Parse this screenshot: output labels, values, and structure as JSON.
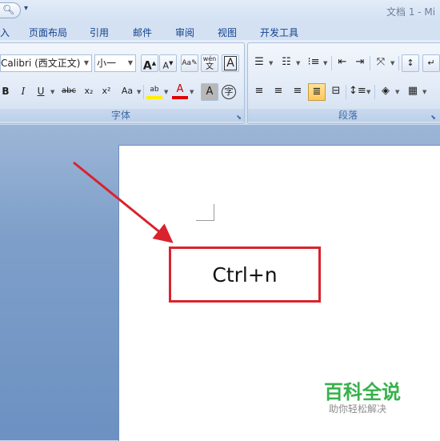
{
  "titlebar": {
    "quick_access_dropdown": "▾",
    "doc_title": "文档 1 - Mi"
  },
  "tabs": [
    {
      "label": "入"
    },
    {
      "label": "页面布局"
    },
    {
      "label": "引用"
    },
    {
      "label": "邮件"
    },
    {
      "label": "审阅"
    },
    {
      "label": "视图"
    },
    {
      "label": "开发工具"
    }
  ],
  "font_group": {
    "label": "字体",
    "font_name": "Calibri (西文正文)",
    "font_size": "小一",
    "grow_font": "A",
    "shrink_font": "A",
    "phonetic_guide": "wén",
    "phonetic_char": "文",
    "char_border": "A",
    "bold": "B",
    "italic": "I",
    "underline": "U",
    "strikethrough": "abc",
    "subscript": "x₂",
    "superscript": "x²",
    "change_case": "Aa",
    "highlight": "ab",
    "font_color": "A",
    "char_shading": "A",
    "enclose_char": "字"
  },
  "paragraph_group": {
    "label": "段落"
  },
  "document": {
    "callout_text": "Ctrl+n"
  },
  "watermark": {
    "title": "百科全说",
    "subtitle": "助你轻松解决"
  },
  "colors": {
    "accent_red": "#d9232d",
    "watermark_green": "#37b14a",
    "ribbon_text": "#15428b"
  }
}
